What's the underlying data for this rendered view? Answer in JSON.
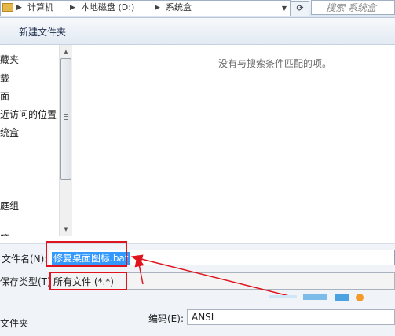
{
  "address_bar": {
    "crumbs": [
      "计算机",
      "本地磁盘 (D:)",
      "系统盒"
    ],
    "search_placeholder": "搜索 系统盒"
  },
  "toolbar": {
    "new_folder_label": "新建文件夹"
  },
  "nav": {
    "items": [
      "藏夹",
      "载",
      "面",
      "近访问的位置",
      "统盒",
      "庭组",
      "算"
    ]
  },
  "main": {
    "empty_message": "没有与搜索条件匹配的项。"
  },
  "form": {
    "filename_label": "文件名(N):",
    "filename_value": "修复桌面图标.bat",
    "filetype_label": "保存类型(T):",
    "filetype_value": "所有文件  (*.*)",
    "encoding_label": "编码(E):",
    "encoding_value": "ANSI",
    "hide_folders_label": "文件夹"
  },
  "colors": {
    "annotation_red": "#e0141e",
    "selection_blue": "#3399ff"
  }
}
